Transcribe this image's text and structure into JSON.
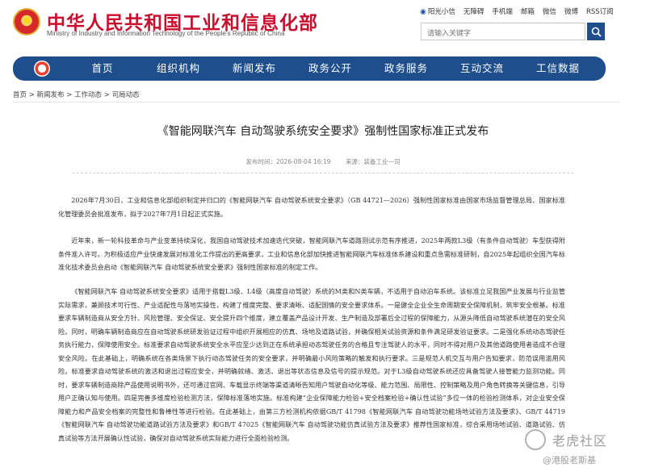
{
  "header": {
    "title": "中华人民共和国工业和信息化部",
    "subtitle": "Ministry of Industry and Information Technology of the People's Republic of China",
    "util_links": [
      "阳光小信",
      "无障碍",
      "手机端",
      "邮箱",
      "微信",
      "微博",
      "RSS订阅"
    ],
    "search_placeholder": "请输入关键字"
  },
  "nav": {
    "items": [
      "首页",
      "组织机构",
      "新闻发布",
      "政务公开",
      "政务服务",
      "互动交流",
      "工信数据"
    ]
  },
  "breadcrumb": "首页 > 新闻发布 > 工作动态 > 司局动态",
  "article": {
    "title": "《智能网联汽车 自动驾驶系统安全要求》强制性国家标准正式发布",
    "publish_time": "发布时间：2026-08-04 16:19",
    "source": "来源：装备工业一司",
    "paragraphs": [
      "2026年7月30日，工业和信息化部组织制定并归口的《智能网联汽车 自动驾驶系统安全要求》（GB 44721—2026）强制性国家标准由国家市场监督管理总局、国家标准化管理委员会批准发布，拟于2027年7月1日起正式实施。",
      "近年来，新一轮科技革命与产业变革持续深化，我国自动驾驶技术加速迭代突破，智能网联汽车道路测试示范有序推进，2025年两款L3级（有条件自动驾驶）车型获得附条件准入许可。为积极适应产业快速发展对标准化工作提出的更高要求，工业和信息化部加快推进智能网联汽车标准体系建设和重点急需标准研制，自2025年起组织全国汽车标准化技术委员会启动《智能网联汽车 自动驾驶系统安全要求》强制性国家标准的制定工作。",
      "《智能网联汽车 自动驾驶系统安全要求》适用于搭载L3级、L4级（高度自动驾驶）系统的M类和N类车辆，不适用于自动泊车系统。该标准立足我国产业发展与行业监管实际需求，兼顾技术可行性、产业适配性与落地实操性，构建了维度完整、要求清晰、适配国情的安全要求体系。一是健全企业全生命周期安全保障机制，筑牢安全根基。标准要求车辆制造商从安全方针、风险管理、安全保证、安全提升四个维度，建立覆盖产品设计开发、生产制造及部署后全过程的保障能力，从源头降低自动驾驶系统潜在的安全风险。同时，明确车辆制造商应在自动驾驶系统研发验证过程中组织开展相应的仿真、场地及道路试验，并确保相关试验资源和条件满足研发验证要求。二是强化系统动态驾驶任务执行能力，保障使用安全。标准要求自动驾驶系统安全水平应至少达到正在系统承担动态驾驶任务的合格且专注驾驶人的水平，同时不得对用户及其他道路使用者造成不合理安全风险。在此基础上，明确系统在各类场景下执行动态驾驶任务的安全要求，并明确最小风险策略的触发和执行要求。三是规范人机交互与用户告知要求，防范误用滥用风险。标准要求自动驾驶系统的激活和退出过程应安全，并明确就绪、激活、退出等状态信息及信号的提示规范。对于L3级自动驾驶系统还应具备驾驶人接管能力监测功能。同时，要求车辆制造商除产品使用说明书外，还可通过官网、车载显示终端等渠道清晰告知用户驾驶自动化等级、能力范围、局限性、控制策略及用户角色转换等关键信息，引导用户正确认知与使用。四是完善多维度检验检测方法，保障标准落地实施。标准构建“企业保障能力检验+安全档案检验+确认性试验”多位一体的检验检测体系，对企业安全保障能力和产品安全档案的完整性和鲁棒性等进行检验。在此基础上，由第三方检测机构依据GB/T 41798《智能网联汽车 自动驾驶功能场地试验方法及要求》、GB/T 44719《智能网联汽车 自动驾驶功能道路试验方法及要求》和GB/T 47025《智能网联汽车 自动驾驶功能仿真试验方法及要求》推荐性国家标准，综合采用场地试验、道路试验、仿真试验等方法开展确认性试验，确保对自动驾驶系统实际能力进行全面检验检测。"
    ]
  },
  "watermark": {
    "main": "老虎社区",
    "sub": "@港股老斯基"
  },
  "colors": {
    "brand_red": "#c8102e",
    "nav_blue": "#1f4e8c"
  },
  "icons": {
    "emblem": "national-emblem-icon",
    "search": "search-icon",
    "nav_logo": "miit-logo-icon",
    "watermark": "tiger-logo-icon"
  }
}
